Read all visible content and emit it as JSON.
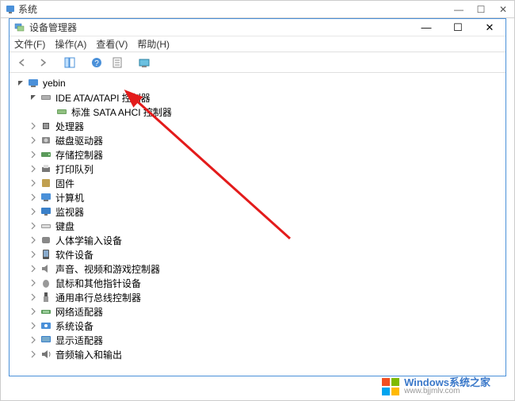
{
  "outerWindow": {
    "title": "系统"
  },
  "innerWindow": {
    "title": "设备管理器"
  },
  "windowControls": {
    "min": "—",
    "max": "☐",
    "close": "✕"
  },
  "menu": {
    "file": "文件(F)",
    "action": "操作(A)",
    "view": "查看(V)",
    "help": "帮助(H)"
  },
  "tree": {
    "root": "yebin",
    "items": [
      {
        "label": "IDE ATA/ATAPI 控制器",
        "icon": "ide",
        "expanded": true,
        "children": [
          {
            "label": "标准 SATA AHCI 控制器",
            "icon": "sata"
          }
        ]
      },
      {
        "label": "处理器",
        "icon": "cpu"
      },
      {
        "label": "磁盘驱动器",
        "icon": "disk"
      },
      {
        "label": "存储控制器",
        "icon": "storage"
      },
      {
        "label": "打印队列",
        "icon": "printer"
      },
      {
        "label": "固件",
        "icon": "firmware"
      },
      {
        "label": "计算机",
        "icon": "computer"
      },
      {
        "label": "监视器",
        "icon": "monitor"
      },
      {
        "label": "键盘",
        "icon": "keyboard"
      },
      {
        "label": "人体学输入设备",
        "icon": "hid"
      },
      {
        "label": "软件设备",
        "icon": "software"
      },
      {
        "label": "声音、视频和游戏控制器",
        "icon": "audio"
      },
      {
        "label": "鼠标和其他指针设备",
        "icon": "mouse"
      },
      {
        "label": "通用串行总线控制器",
        "icon": "usb"
      },
      {
        "label": "网络适配器",
        "icon": "network"
      },
      {
        "label": "系统设备",
        "icon": "system"
      },
      {
        "label": "显示适配器",
        "icon": "display"
      },
      {
        "label": "音频输入和输出",
        "icon": "audioio"
      }
    ]
  },
  "watermark": {
    "line1": "Windows系统之家",
    "line2": "www.bjjmlv.com"
  }
}
